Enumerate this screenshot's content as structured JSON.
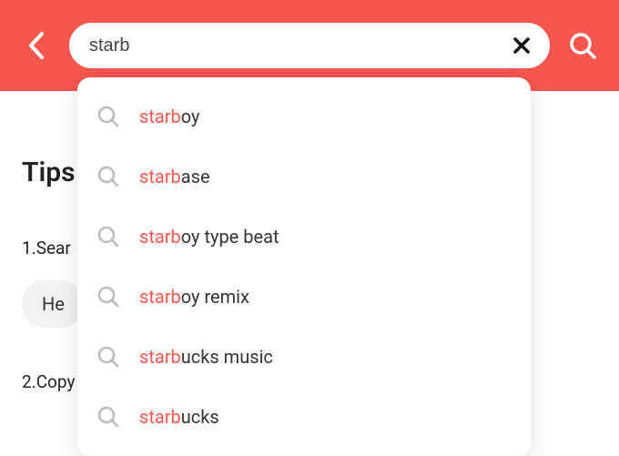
{
  "colors": {
    "accent": "#f7574f",
    "icon_gray": "#bbbbbb",
    "text": "#333333"
  },
  "search": {
    "value": "starb",
    "placeholder": ""
  },
  "suggestions": [
    {
      "prefix": "starb",
      "rest": "oy"
    },
    {
      "prefix": "starb",
      "rest": "ase"
    },
    {
      "prefix": "starb",
      "rest": "oy type beat"
    },
    {
      "prefix": "starb",
      "rest": "oy remix"
    },
    {
      "prefix": "starb",
      "rest": "ucks music"
    },
    {
      "prefix": "starb",
      "rest": "ucks"
    }
  ],
  "background": {
    "tips_title": "Tips",
    "tip1": "1.Sear",
    "chip": "He",
    "tip2": "2.Copy"
  }
}
